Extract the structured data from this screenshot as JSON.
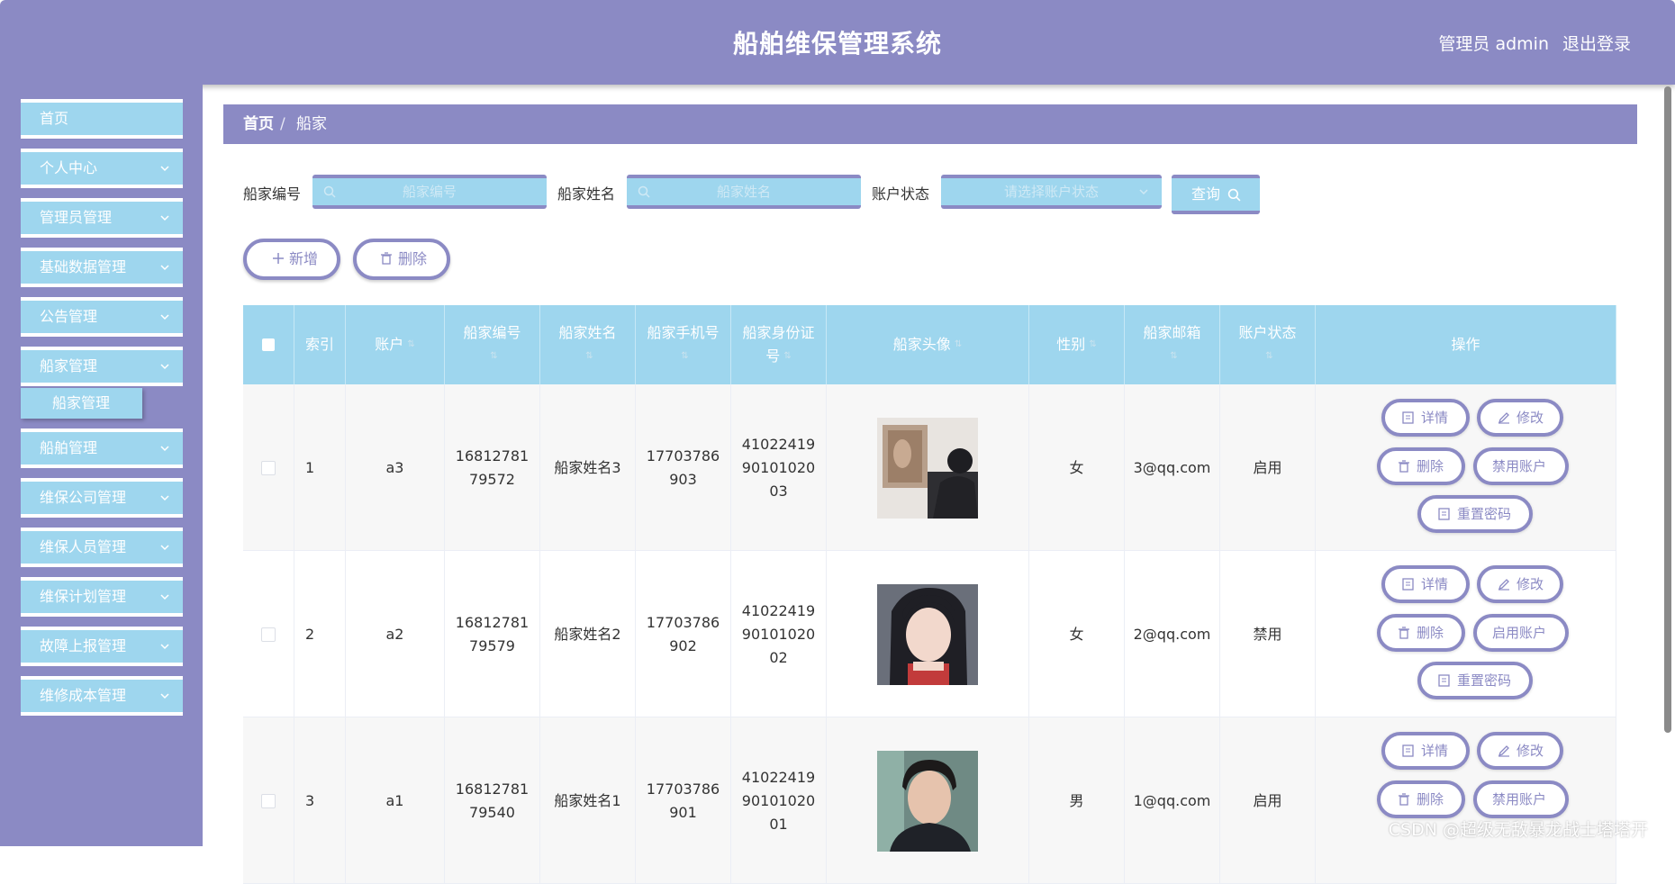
{
  "header": {
    "title": "船舶维保管理系统",
    "admin_label": "管理员 admin",
    "logout_label": "退出登录"
  },
  "sidebar": {
    "items": [
      {
        "label": "首页",
        "has_arrow": false
      },
      {
        "label": "个人中心",
        "has_arrow": true
      },
      {
        "label": "管理员管理",
        "has_arrow": true
      },
      {
        "label": "基础数据管理",
        "has_arrow": true
      },
      {
        "label": "公告管理",
        "has_arrow": true
      },
      {
        "label": "船家管理",
        "has_arrow": true
      },
      {
        "label": "船舶管理",
        "has_arrow": true
      },
      {
        "label": "维保公司管理",
        "has_arrow": true
      },
      {
        "label": "维保人员管理",
        "has_arrow": true
      },
      {
        "label": "维保计划管理",
        "has_arrow": true
      },
      {
        "label": "故障上报管理",
        "has_arrow": true
      },
      {
        "label": "维修成本管理",
        "has_arrow": true
      }
    ],
    "submenu": {
      "label": "船家管理"
    }
  },
  "breadcrumb": {
    "home": "首页",
    "separator": "/",
    "current": "船家"
  },
  "search": {
    "fields": [
      {
        "label": "船家编号",
        "placeholder": "船家编号"
      },
      {
        "label": "船家姓名",
        "placeholder": "船家姓名"
      },
      {
        "label": "账户状态",
        "placeholder": "请选择账户状态"
      }
    ],
    "query_label": "查询"
  },
  "actions": {
    "add_label": "新增",
    "delete_label": "删除"
  },
  "table": {
    "headers": [
      "索引",
      "账户",
      "船家编号",
      "船家姓名",
      "船家手机号",
      "船家身份证号",
      "船家头像",
      "性别",
      "船家邮箱",
      "账户状态",
      "操作"
    ],
    "rows": [
      {
        "index": "1",
        "account": "a3",
        "code": [
          "16812781",
          "79572"
        ],
        "name": "船家姓名3",
        "phone": [
          "17703786",
          "903"
        ],
        "id_card": [
          "41022419",
          "90101020",
          "03"
        ],
        "avatar": "avatar-photo-1",
        "gender": "女",
        "email": "3@qq.com",
        "status": "启用",
        "toggle_label": "禁用账户"
      },
      {
        "index": "2",
        "account": "a2",
        "code": [
          "16812781",
          "79579"
        ],
        "name": "船家姓名2",
        "phone": [
          "17703786",
          "902"
        ],
        "id_card": [
          "41022419",
          "90101020",
          "02"
        ],
        "avatar": "avatar-photo-2",
        "gender": "女",
        "email": "2@qq.com",
        "status": "禁用",
        "toggle_label": "启用账户"
      },
      {
        "index": "3",
        "account": "a1",
        "code": [
          "16812781",
          "79540"
        ],
        "name": "船家姓名1",
        "phone": [
          "17703786",
          "901"
        ],
        "id_card": [
          "41022419",
          "90101020",
          "01"
        ],
        "avatar": "avatar-photo-3",
        "gender": "男",
        "email": "1@qq.com",
        "status": "启用",
        "toggle_label": "禁用账户"
      }
    ],
    "op_labels": {
      "detail": "详情",
      "edit": "修改",
      "delete": "删除",
      "reset": "重置密码"
    }
  },
  "watermark": "CSDN @超级无敌暴龙战士塔塔开",
  "colors": {
    "primary": "#8b8ac4",
    "accent": "#9ed6ee",
    "row_alt": "#f7f7f7"
  }
}
